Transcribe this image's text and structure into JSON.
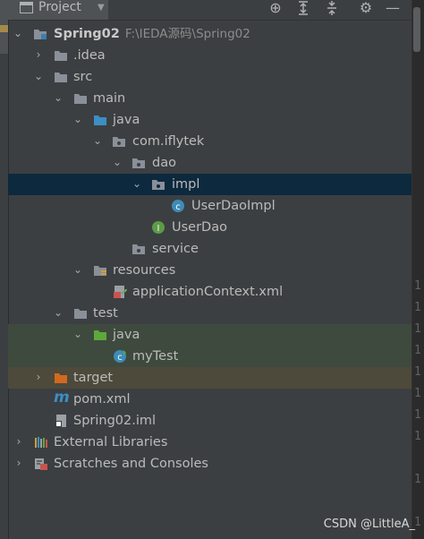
{
  "header": {
    "title": "Project",
    "dropdown_icon": "chevron-down-icon"
  },
  "toolbar": {
    "icons": [
      "locate-icon",
      "expand-all-icon",
      "collapse-all-icon",
      "gear-icon",
      "hide-icon"
    ]
  },
  "tree": {
    "project_name": "Spring02",
    "project_path": "F:\\IEDA源码\\Spring02",
    "idea": ".idea",
    "src": "src",
    "main": "main",
    "java": "java",
    "package": "com.iflytek",
    "dao": "dao",
    "impl": "impl",
    "user_dao_impl": "UserDaoImpl",
    "user_dao": "UserDao",
    "service": "service",
    "resources": "resources",
    "app_context": "applicationContext.xml",
    "test": "test",
    "test_java": "java",
    "my_test": "myTest",
    "target": "target",
    "pom": "pom.xml",
    "iml": "Spring02.iml",
    "external_libraries": "External Libraries",
    "scratches": "Scratches and Consoles"
  },
  "gutter": [
    "1",
    "1",
    "1",
    "1",
    "1",
    "1",
    "1",
    "1",
    "1",
    "1"
  ],
  "watermark": "CSDN @LittleA_",
  "colors": {
    "background": "#3c3f41",
    "selection": "#0d293e",
    "test_highlight": "#3e4a3d",
    "excluded_highlight": "#4d4a3b",
    "folder_blue": "#3b8fc4",
    "test_green": "#5ea83b",
    "excluded_orange": "#d2691e"
  }
}
